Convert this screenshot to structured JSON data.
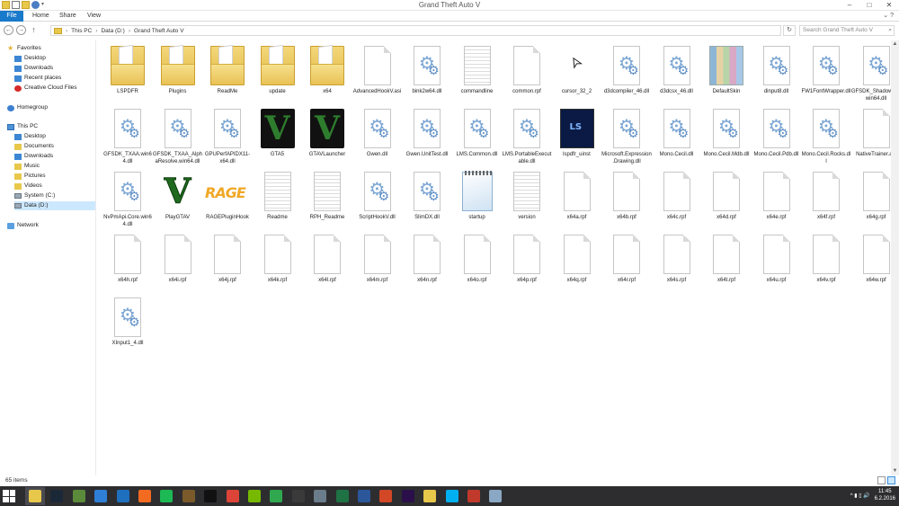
{
  "window": {
    "title": "Grand Theft Auto V",
    "controls": [
      "–",
      "□",
      "✕"
    ]
  },
  "ribbon": {
    "tabs": [
      "File",
      "Home",
      "Share",
      "View"
    ],
    "expand": "⌄ ?"
  },
  "address": {
    "path": [
      "This PC",
      "Data (D:)",
      "Grand Theft Auto V"
    ],
    "search_placeholder": "Search Grand Theft Auto V"
  },
  "sidebar": {
    "favorites_label": "Favorites",
    "favorites": [
      "Desktop",
      "Downloads",
      "Recent places",
      "Creative Cloud Files"
    ],
    "homegroup": "Homegroup",
    "thispc_label": "This PC",
    "thispc": [
      "Desktop",
      "Documents",
      "Downloads",
      "Music",
      "Pictures",
      "Videos",
      "System (C:)",
      "Data (D:)"
    ],
    "network": "Network"
  },
  "files": [
    {
      "name": "LSPDFR",
      "type": "folder"
    },
    {
      "name": "Plugins",
      "type": "folder"
    },
    {
      "name": "ReadMe",
      "type": "folder"
    },
    {
      "name": "update",
      "type": "folder"
    },
    {
      "name": "x64",
      "type": "folder"
    },
    {
      "name": "AdvancedHookV.asi",
      "type": "file"
    },
    {
      "name": "bink2w64.dll",
      "type": "dll"
    },
    {
      "name": "commandline",
      "type": "text"
    },
    {
      "name": "common.rpf",
      "type": "file"
    },
    {
      "name": "cursor_32_2",
      "type": "cursor"
    },
    {
      "name": "d3dcompiler_46.dll",
      "type": "dll"
    },
    {
      "name": "d3dcsx_46.dll",
      "type": "dll"
    },
    {
      "name": "DefaultSkin",
      "type": "skin"
    },
    {
      "name": "dinput8.dll",
      "type": "dll"
    },
    {
      "name": "FW1FontWrapper.dll",
      "type": "dll"
    },
    {
      "name": "GFSDK_ShadowLib.win64.dll",
      "type": "dll"
    },
    {
      "name": "GFSDK_TXAA.win64.dll",
      "type": "dll"
    },
    {
      "name": "GFSDK_TXAA_AlphaResolve.win64.dll",
      "type": "dll"
    },
    {
      "name": "GPUPerfAPIDX11-x64.dll",
      "type": "dll"
    },
    {
      "name": "GTA5",
      "type": "gta"
    },
    {
      "name": "GTAVLauncher",
      "type": "gta"
    },
    {
      "name": "Gwen.dll",
      "type": "dll"
    },
    {
      "name": "Gwen.UnitTest.dll",
      "type": "dll"
    },
    {
      "name": "LMS.Common.dll",
      "type": "dll"
    },
    {
      "name": "LMS.PortableExecutable.dll",
      "type": "dll"
    },
    {
      "name": "lspdfr_uinst",
      "type": "lspdfr"
    },
    {
      "name": "Microsoft.Expression.Drawing.dll",
      "type": "dll"
    },
    {
      "name": "Mono.Cecil.dll",
      "type": "dll"
    },
    {
      "name": "Mono.Cecil.Mdb.dll",
      "type": "dll"
    },
    {
      "name": "Mono.Cecil.Pdb.dll",
      "type": "dll"
    },
    {
      "name": "Mono.Cecil.Rocks.dll",
      "type": "dll"
    },
    {
      "name": "NativeTrainer.asi",
      "type": "file"
    },
    {
      "name": "NvPmApi.Core.win64.dll",
      "type": "dll"
    },
    {
      "name": "PlayGTAV",
      "type": "gtaw"
    },
    {
      "name": "RAGEPluginHook",
      "type": "rage"
    },
    {
      "name": "Readme",
      "type": "text"
    },
    {
      "name": "RPH_Readme",
      "type": "text"
    },
    {
      "name": "ScriptHookV.dll",
      "type": "dll"
    },
    {
      "name": "SlimDX.dll",
      "type": "dll"
    },
    {
      "name": "startup",
      "type": "note"
    },
    {
      "name": "version",
      "type": "text"
    },
    {
      "name": "x64a.rpf",
      "type": "file"
    },
    {
      "name": "x64b.rpf",
      "type": "file"
    },
    {
      "name": "x64c.rpf",
      "type": "file"
    },
    {
      "name": "x64d.rpf",
      "type": "file"
    },
    {
      "name": "x64e.rpf",
      "type": "file"
    },
    {
      "name": "x64f.rpf",
      "type": "file"
    },
    {
      "name": "x64g.rpf",
      "type": "file"
    },
    {
      "name": "x64h.rpf",
      "type": "file"
    },
    {
      "name": "x64i.rpf",
      "type": "file"
    },
    {
      "name": "x64j.rpf",
      "type": "file"
    },
    {
      "name": "x64k.rpf",
      "type": "file"
    },
    {
      "name": "x64l.rpf",
      "type": "file"
    },
    {
      "name": "x64m.rpf",
      "type": "file"
    },
    {
      "name": "x64n.rpf",
      "type": "file"
    },
    {
      "name": "x64o.rpf",
      "type": "file"
    },
    {
      "name": "x64p.rpf",
      "type": "file"
    },
    {
      "name": "x64q.rpf",
      "type": "file"
    },
    {
      "name": "x64r.rpf",
      "type": "file"
    },
    {
      "name": "x64s.rpf",
      "type": "file"
    },
    {
      "name": "x64t.rpf",
      "type": "file"
    },
    {
      "name": "x64u.rpf",
      "type": "file"
    },
    {
      "name": "x64v.rpf",
      "type": "file"
    },
    {
      "name": "x64w.rpf",
      "type": "file"
    },
    {
      "name": "XInput1_4.dll",
      "type": "dll"
    }
  ],
  "status": {
    "count": "65 items"
  },
  "taskbar": {
    "apps": [
      {
        "name": "explorer",
        "color": "#e8c84a",
        "active": true
      },
      {
        "name": "steam",
        "color": "#1b2838"
      },
      {
        "name": "minecraft",
        "color": "#5b8a3a"
      },
      {
        "name": "uplay",
        "color": "#2f7fd6"
      },
      {
        "name": "app-blue",
        "color": "#1f6fbf"
      },
      {
        "name": "origin",
        "color": "#f26b21"
      },
      {
        "name": "spotify",
        "color": "#1db954"
      },
      {
        "name": "afterburner",
        "color": "#7a5a2a"
      },
      {
        "name": "gta-taskbar",
        "color": "#111111"
      },
      {
        "name": "chrome",
        "color": "#db4437"
      },
      {
        "name": "nvidia",
        "color": "#76b900"
      },
      {
        "name": "cloud",
        "color": "#2fa84f"
      },
      {
        "name": "obs",
        "color": "#3a3a3a"
      },
      {
        "name": "warships",
        "color": "#6b7c8a"
      },
      {
        "name": "excel",
        "color": "#1f7244"
      },
      {
        "name": "word",
        "color": "#2b579a"
      },
      {
        "name": "powerpoint",
        "color": "#d24726"
      },
      {
        "name": "premiere",
        "color": "#2a0f4a"
      },
      {
        "name": "folder2",
        "color": "#e8c84a"
      },
      {
        "name": "skype",
        "color": "#00aff0"
      },
      {
        "name": "flag",
        "color": "#c0392b"
      },
      {
        "name": "paint",
        "color": "#8aa7c4"
      }
    ],
    "tray": "^ ▮ ▯ 🔊",
    "time": "11:45",
    "date": "6.2.2016"
  }
}
